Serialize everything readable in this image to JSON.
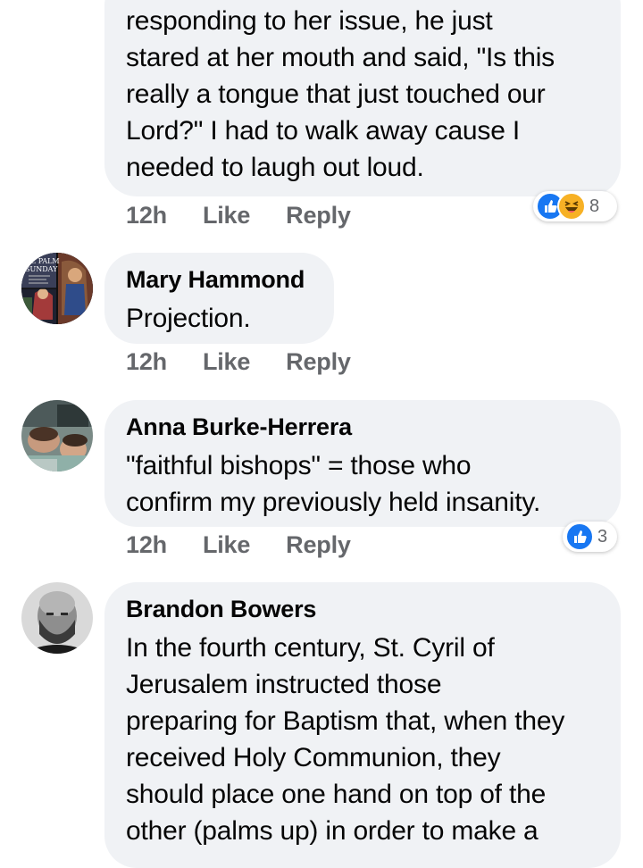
{
  "comments": [
    {
      "author": "",
      "text": "responding to her issue, he just\nstared at her mouth and said, \"Is this\nreally a tongue that just touched our\nLord?\"  I had to walk away cause I\nneeded to laugh out loud.",
      "time": "12h",
      "like_label": "Like",
      "reply_label": "Reply",
      "reactions": [
        "like",
        "haha"
      ],
      "reaction_count": "8"
    },
    {
      "author": "Mary Hammond",
      "text": "Projection.",
      "time": "12h",
      "like_label": "Like",
      "reply_label": "Reply",
      "avatar_text": "LE PALM\nSUNDAY"
    },
    {
      "author": "Anna Burke-Herrera",
      "text": "\"faithful bishops\" = those who\nconfirm my previously held insanity.",
      "time": "12h",
      "like_label": "Like",
      "reply_label": "Reply",
      "reactions": [
        "like"
      ],
      "reaction_count": "3"
    },
    {
      "author": "Brandon Bowers",
      "text": "In the fourth century, St. Cyril of\nJerusalem instructed those\npreparing for Baptism that, when they\nreceived Holy Communion, they\nshould place one hand on top of the\nother (palms up) in order to make a"
    }
  ],
  "colors": {
    "bubble": "#f0f2f5",
    "meta": "#65676b",
    "like_blue": "#1877f2",
    "haha_yellow": "#f7b125"
  }
}
